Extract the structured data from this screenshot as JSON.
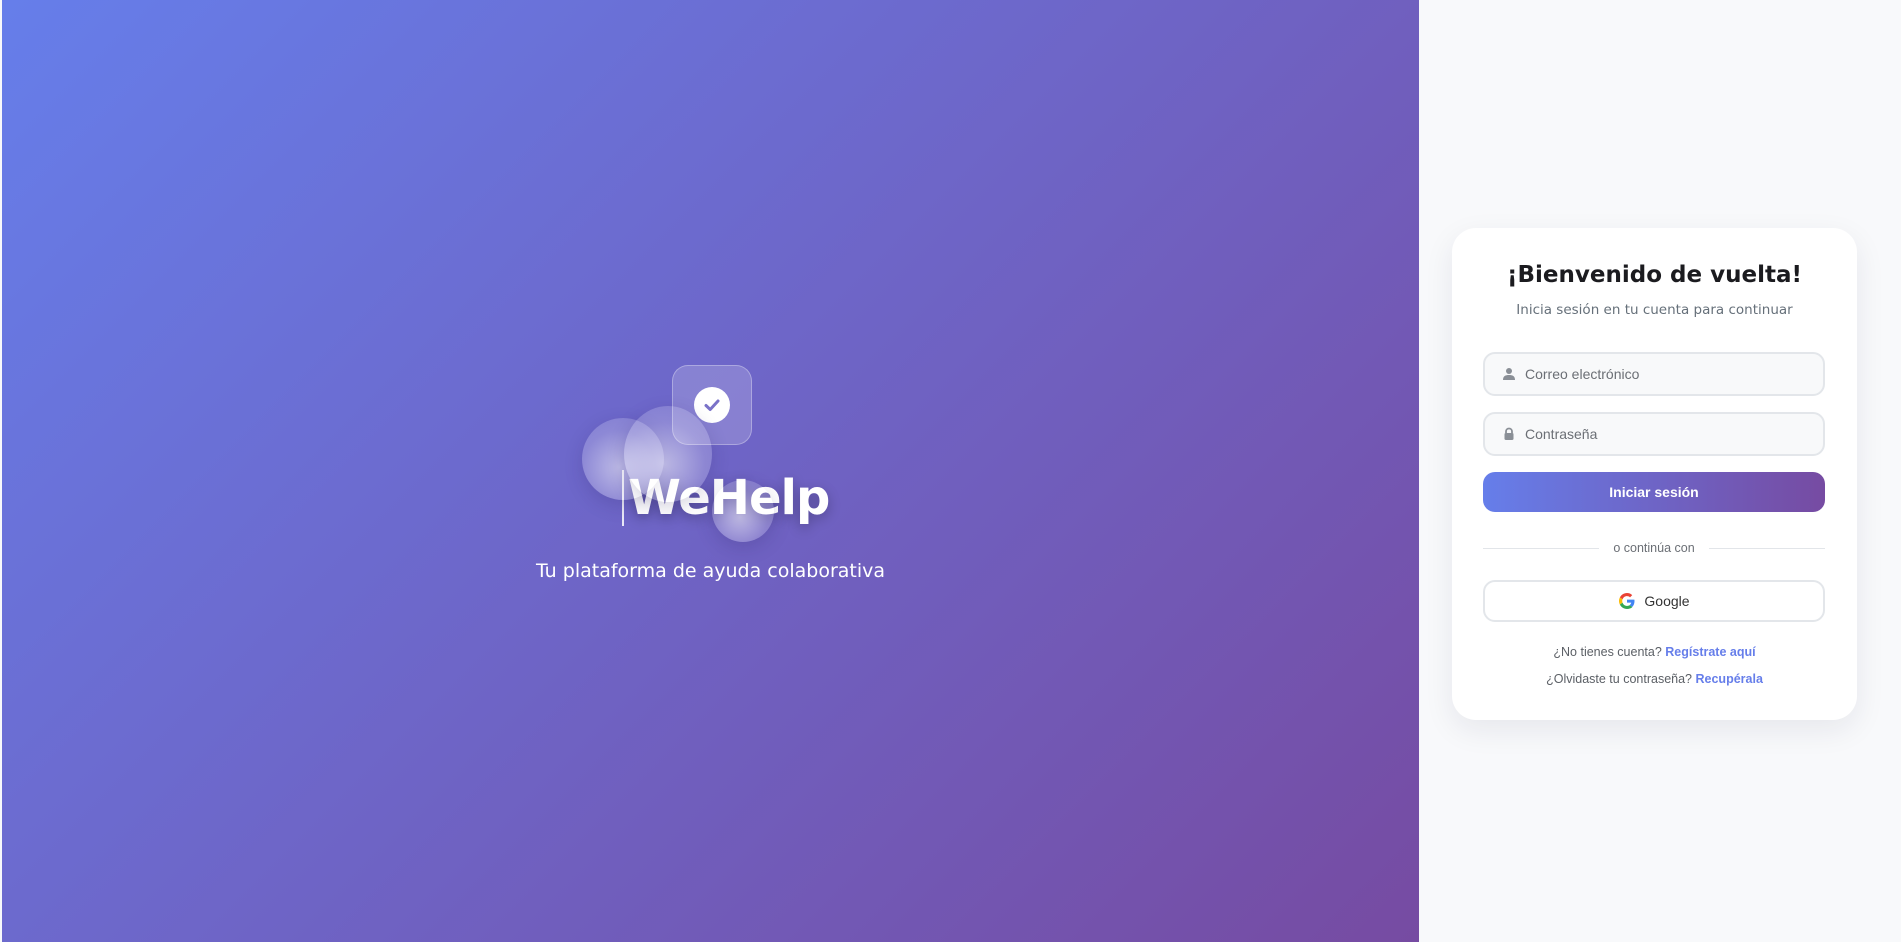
{
  "hero": {
    "brand_name": "WeHelp",
    "tagline": "Tu plataforma de ayuda colaborativa",
    "gradient_start": "#667eea",
    "gradient_end": "#764ba2",
    "badge_icon": "check-icon"
  },
  "login": {
    "title": "¡Bienvenido de vuelta!",
    "subtitle": "Inicia sesión en tu cuenta para continuar",
    "email_placeholder": "Correo electrónico",
    "email_icon": "user-icon",
    "password_placeholder": "Contraseña",
    "password_icon": "lock-icon",
    "submit_label": "Iniciar sesión",
    "divider_text": "o continúa con",
    "google_label": "Google",
    "google_icon": "google-icon",
    "no_account_text": "¿No tienes cuenta?",
    "register_link": "Regístrate aquí",
    "forgot_text": "¿Olvidaste tu contraseña?",
    "recover_link": "Recupérala",
    "accent_color": "#667eea"
  }
}
